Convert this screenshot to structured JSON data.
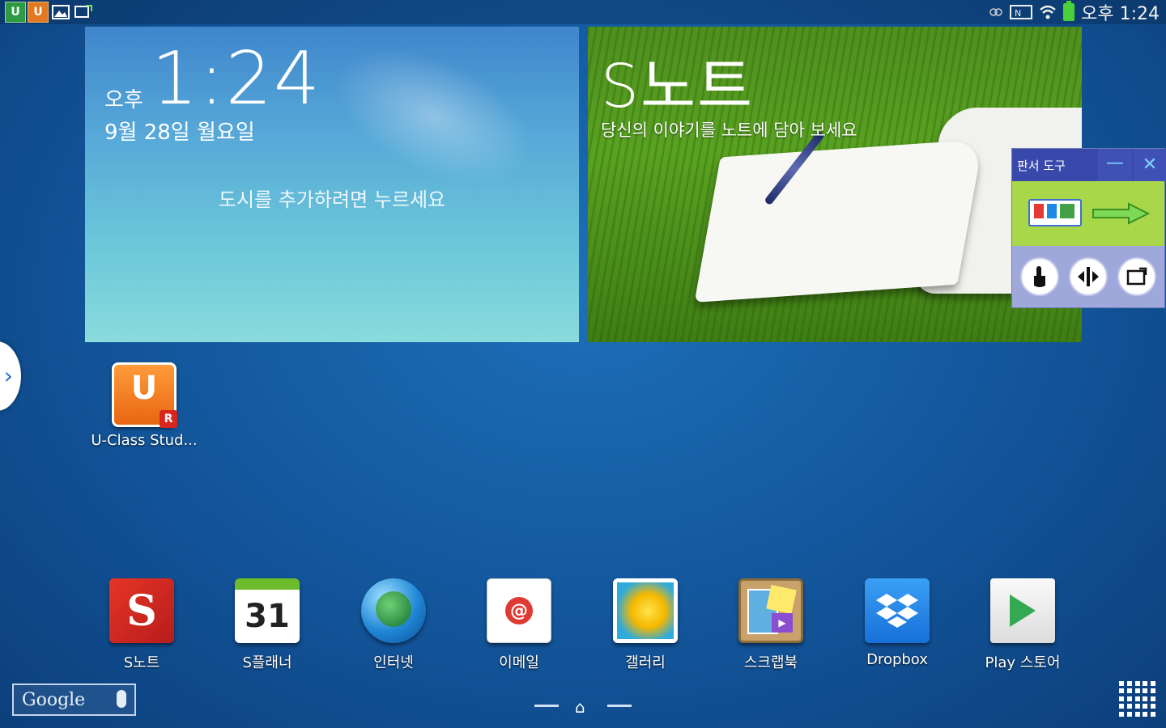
{
  "status_bar": {
    "notif_icons": [
      "U",
      "U"
    ],
    "time": "오후 1:24"
  },
  "clock_widget": {
    "ampm": "오후",
    "time": "1:24",
    "date": "9월 28일 월요일",
    "city_prompt": "도시를 추가하려면 누르세요"
  },
  "snote_widget": {
    "title": "S노트",
    "subtitle": "당신의 이야기를 노트에 담아 보세요"
  },
  "tool_panel": {
    "title": "판서 도구",
    "minimize": "—",
    "close": "✕"
  },
  "desktop_apps": [
    {
      "label": "U-Class Stud..."
    }
  ],
  "dock_apps": [
    {
      "label": "S노트"
    },
    {
      "label": "S플래너",
      "icon_text": "31"
    },
    {
      "label": "인터넷"
    },
    {
      "label": "이메일"
    },
    {
      "label": "갤러리"
    },
    {
      "label": "스크랩북"
    },
    {
      "label": "Dropbox"
    },
    {
      "label": "Play 스토어"
    }
  ],
  "google_search": {
    "logo": "Google"
  },
  "colors": {
    "background": "#145aa1",
    "panel_header": "#3949ab",
    "panel_green": "#a8d84a",
    "accent_cyan": "#7dd3ff"
  }
}
